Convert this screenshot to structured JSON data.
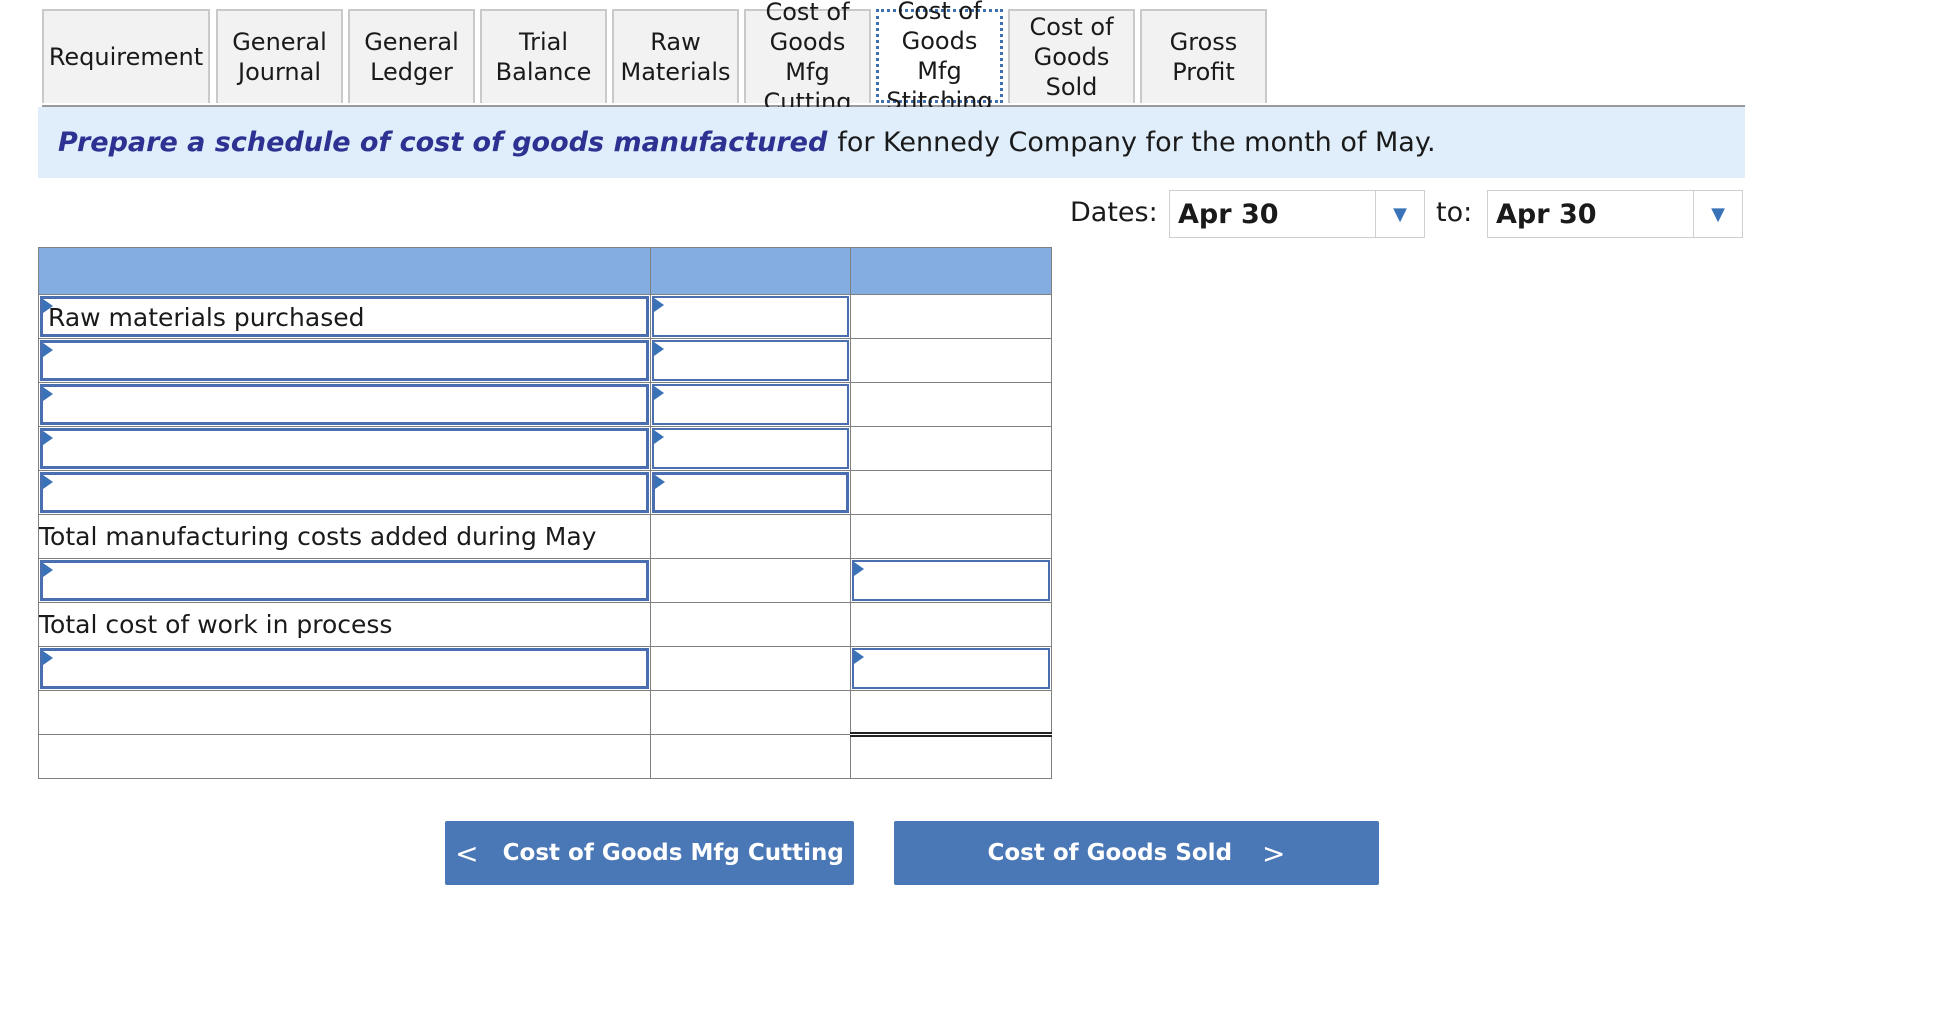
{
  "tabs": [
    {
      "label": "Requirement"
    },
    {
      "label": "General\nJournal"
    },
    {
      "label": "General\nLedger"
    },
    {
      "label": "Trial Balance"
    },
    {
      "label": "Raw\nMaterials"
    },
    {
      "label": "Cost of\nGoods Mfg\nCutting"
    },
    {
      "label": "Cost of\nGoods Mfg\nStitching"
    },
    {
      "label": "Cost of\nGoods Sold"
    },
    {
      "label": "Gross Profit"
    }
  ],
  "active_tab": "Cost of Goods Mfg Stitching",
  "instruction": {
    "emphasis": "Prepare a schedule of cost of goods manufactured",
    "rest": "for Kennedy Company for the month of May."
  },
  "dates": {
    "label": "Dates:",
    "from": "Apr 30",
    "to_label": "to:",
    "to": "Apr 30"
  },
  "table": {
    "rows": [
      {
        "label": "Raw materials purchased"
      },
      {
        "label": ""
      },
      {
        "label": ""
      },
      {
        "label": ""
      },
      {
        "label": ""
      },
      {
        "label": "Total manufacturing costs added during May"
      },
      {
        "label": ""
      },
      {
        "label": "Total cost of work in process"
      },
      {
        "label": ""
      },
      {
        "label": ""
      },
      {
        "label": ""
      }
    ]
  },
  "nav": {
    "prev_label": "Cost of Goods Mfg Cutting",
    "next_label": "Cost of Goods Sold",
    "prev_chevron": "<",
    "next_chevron": ">"
  },
  "colors": {
    "header": "#84aee2",
    "banner": "#dfeefa",
    "button": "#4a77b6",
    "input_border": "#4a6fb0"
  }
}
